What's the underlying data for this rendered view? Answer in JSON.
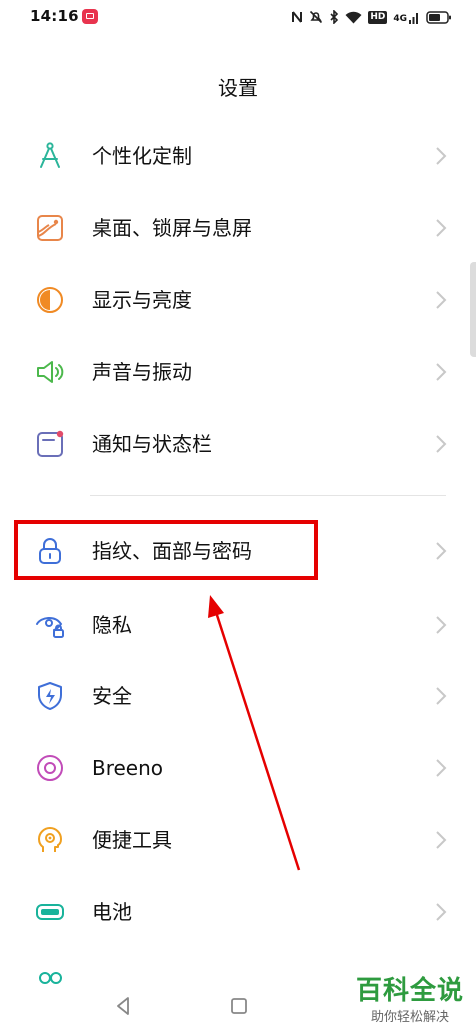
{
  "status_bar": {
    "time": "14:16",
    "app_icon": "red-app-icon",
    "icons": [
      "nfc-icon",
      "mute-icon",
      "bluetooth-icon",
      "wifi-icon",
      "hd-icon",
      "4g-signal-icon",
      "battery-icon"
    ],
    "hd_text": "HD",
    "network_text": "4G"
  },
  "header": {
    "title": "设置"
  },
  "settings_list": [
    {
      "label": "个性化定制",
      "icon": "compass-icon",
      "icon_color": "#2bb59a"
    },
    {
      "label": "桌面、锁屏与息屏",
      "icon": "wallpaper-icon",
      "icon_color": "#e8864a"
    },
    {
      "label": "显示与亮度",
      "icon": "brightness-icon",
      "icon_color": "#f08a24"
    },
    {
      "label": "声音与振动",
      "icon": "speaker-icon",
      "icon_color": "#4cb84c"
    },
    {
      "label": "通知与状态栏",
      "icon": "notification-icon",
      "icon_color": "#e24b6a"
    },
    {
      "label": "指纹、面部与密码",
      "icon": "lock-icon",
      "icon_color": "#3f6fd8"
    },
    {
      "label": "隐私",
      "icon": "privacy-eye-icon",
      "icon_color": "#3f6fd8"
    },
    {
      "label": "安全",
      "icon": "shield-icon",
      "icon_color": "#3f6fd8"
    },
    {
      "label": "Breeno",
      "icon": "breeno-icon",
      "icon_color": "#c14bb8"
    },
    {
      "label": "便捷工具",
      "icon": "head-gear-icon",
      "icon_color": "#f0a020"
    },
    {
      "label": "电池",
      "icon": "battery-icon",
      "icon_color": "#19b39b"
    }
  ],
  "annotation": {
    "highlight_color": "#e50000",
    "highlighted_item": "指纹、面部与密码"
  },
  "watermark": {
    "logo": "百科全说",
    "subtitle": "助你轻松解决"
  }
}
